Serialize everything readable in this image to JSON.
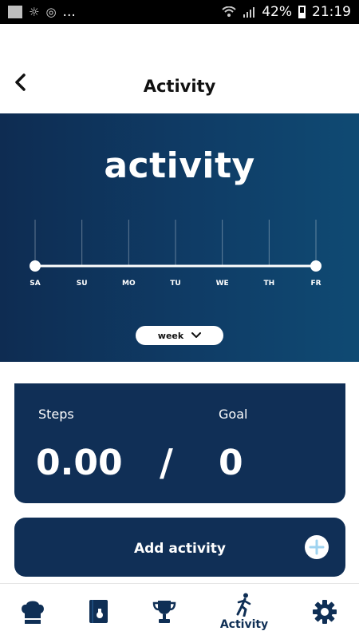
{
  "status_bar": {
    "battery": "42%",
    "time": "21:19",
    "dots": "..."
  },
  "header": {
    "title": "Activity"
  },
  "hero": {
    "title": "activity",
    "period_selector": "week",
    "days": [
      "SA",
      "SU",
      "MO",
      "TU",
      "WE",
      "TH",
      "FR"
    ],
    "activity_values": [
      0,
      0,
      0,
      0,
      0,
      0,
      0
    ]
  },
  "steps_card": {
    "steps_label": "Steps",
    "goal_label": "Goal",
    "steps_value": "0.00",
    "separator": "/",
    "goal_value": "0"
  },
  "add_activity": {
    "label": "Add activity"
  },
  "bottom_nav": {
    "active_label": "Activity",
    "items": [
      "chef-hat-icon",
      "recipe-book-icon",
      "trophy-icon",
      "running-icon",
      "gear-icon"
    ]
  },
  "colors": {
    "primary_navy": "#102f56",
    "hero_gradient_start": "#0e2c52",
    "hero_gradient_end": "#0f4a73",
    "accent_light_blue": "#9ed3f0"
  }
}
